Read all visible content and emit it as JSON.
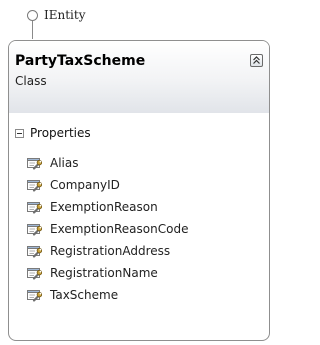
{
  "interface": {
    "name": "IEntity",
    "icon": "interface-lollipop-icon"
  },
  "class": {
    "name": "PartyTaxScheme",
    "kind": "Class",
    "collapse_icon": "double-chevron-up-icon",
    "sections": {
      "properties": {
        "label": "Properties",
        "expand_icon": "minus-box-icon",
        "item_icon": "property-wrench-icon",
        "items": [
          "Alias",
          "CompanyID",
          "ExemptionReason",
          "ExemptionReasonCode",
          "RegistrationAddress",
          "RegistrationName",
          "TaxScheme"
        ]
      }
    }
  },
  "colors": {
    "border": "#8f8f8f",
    "header_gradient_bottom": "#e1e4e9"
  }
}
